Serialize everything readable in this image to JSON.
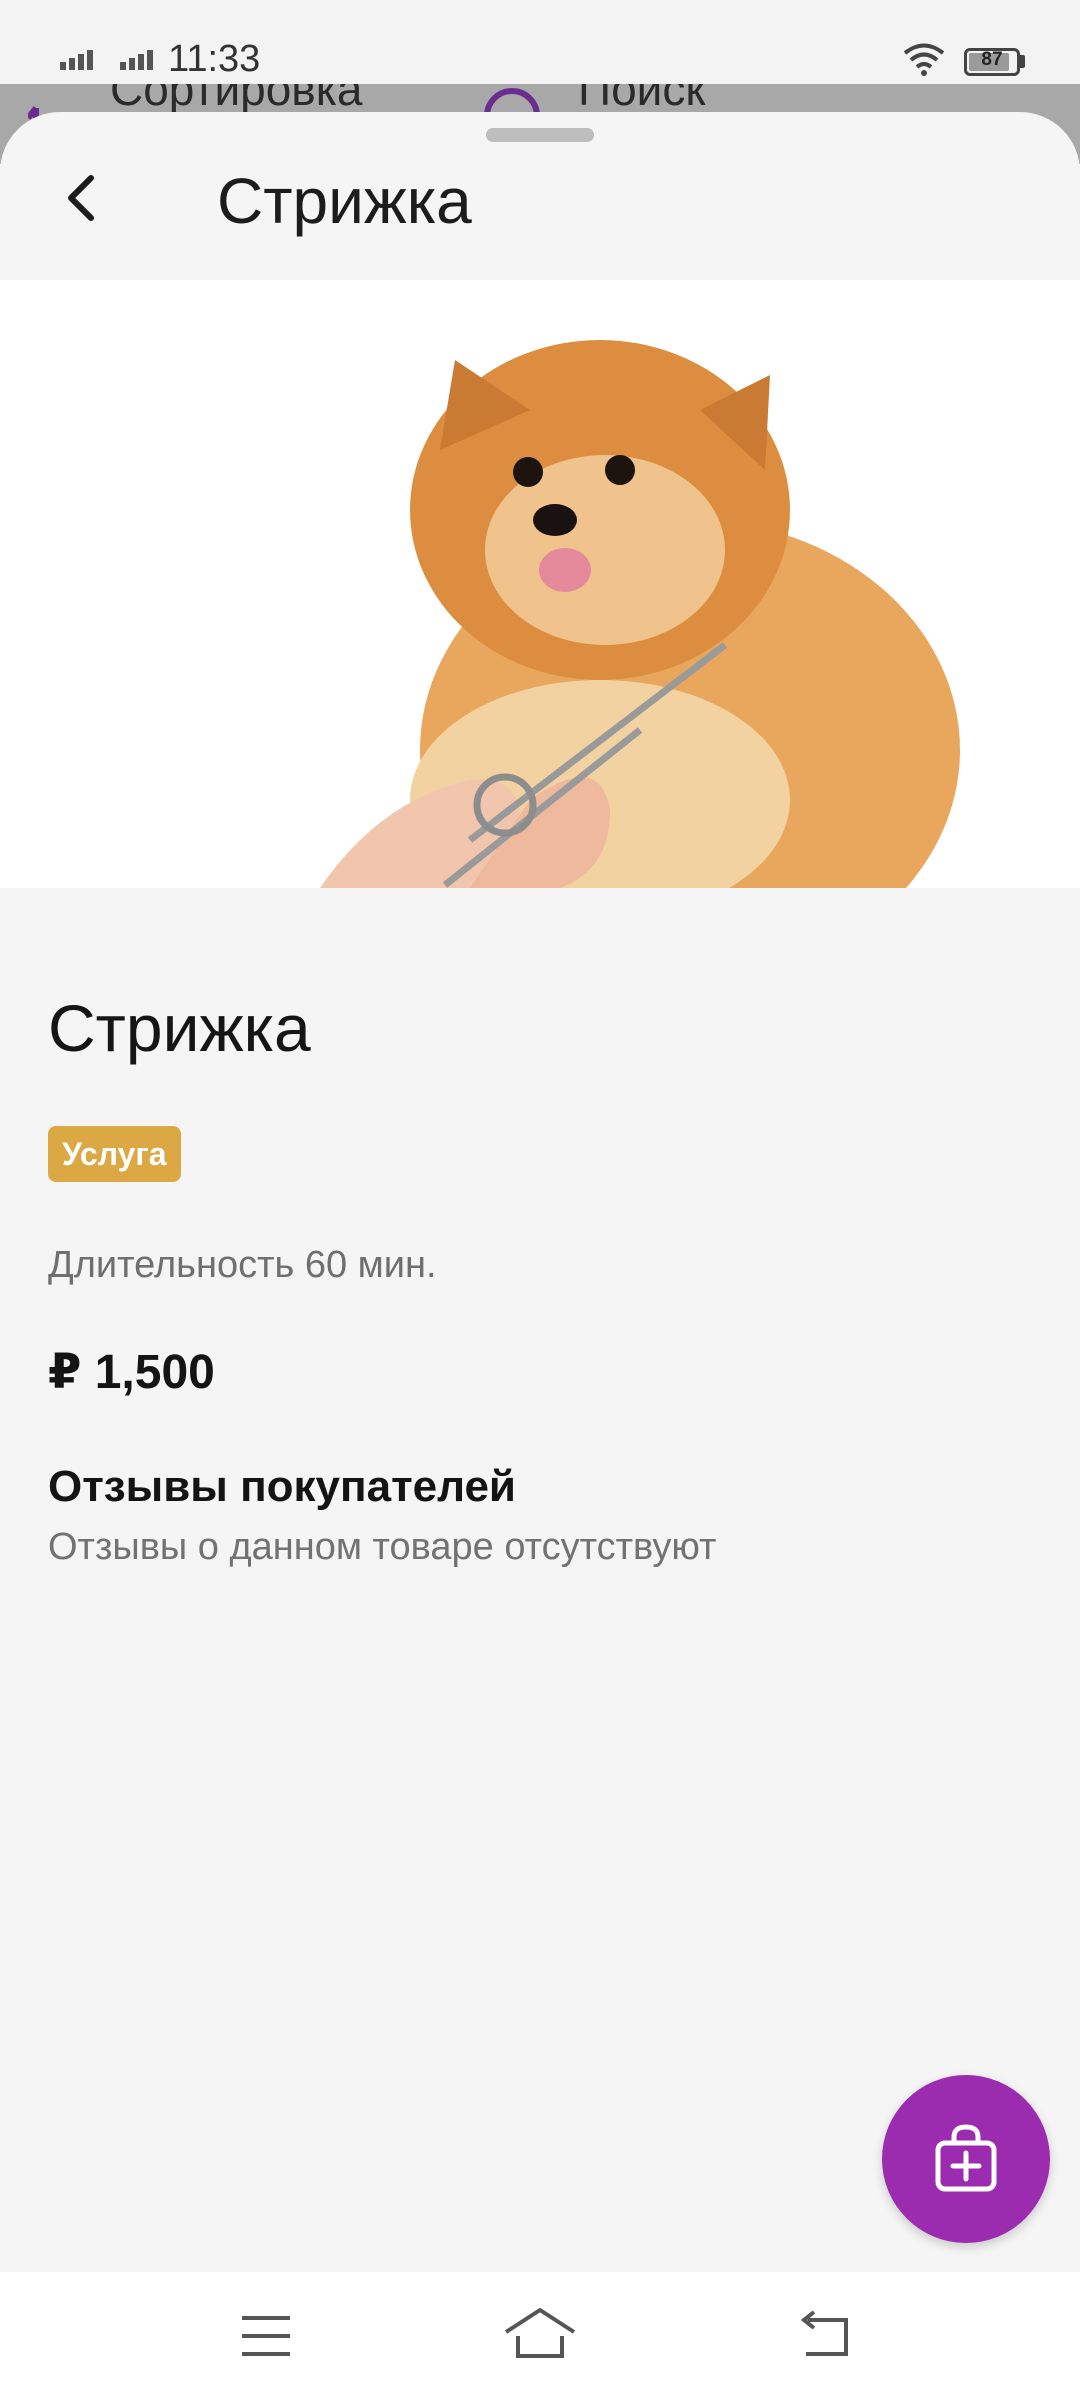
{
  "status_bar": {
    "time": "11:33",
    "battery": "87",
    "battery_level": 0.87,
    "icons": [
      "signal-icon",
      "signal-icon",
      "wifi-icon",
      "battery-icon"
    ]
  },
  "background_page": {
    "sort_label": "Сортировка",
    "search_label": "Поиск"
  },
  "header": {
    "title": "Стрижка",
    "back_icon": "chevron-left-icon"
  },
  "hero_image": {
    "description": "pomeranian-grooming-photo"
  },
  "product": {
    "title": "Стрижка",
    "badge": "Услуга",
    "duration": "Длительность 60 мин.",
    "price": "₽ 1,500"
  },
  "reviews": {
    "heading": "Отзывы покупателей",
    "empty_text": "Отзывы о данном товаре отсутствуют"
  },
  "fab": {
    "icon": "add-to-bag-icon"
  },
  "nav_bar": {
    "icons": [
      "menu-icon",
      "home-icon",
      "back-icon"
    ]
  },
  "colors": {
    "accent": "#9b2cb0",
    "badge": "#dca843",
    "background": "#f5f5f5"
  }
}
